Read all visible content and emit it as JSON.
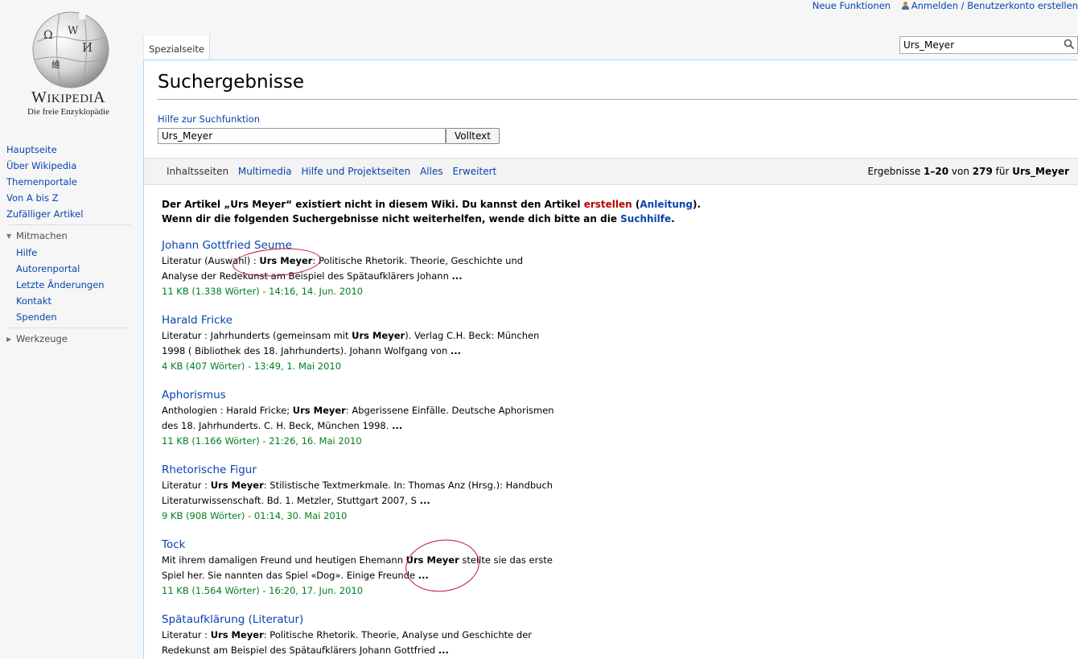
{
  "personal": {
    "new_features": "Neue Funktionen",
    "login": "Anmelden / Benutzerkonto erstellen"
  },
  "logo": {
    "wordmark_w": "W",
    "wordmark_rest": "IKIPEDI",
    "wordmark_a": "A",
    "tagline": "Die freie Enzyklopädie",
    "globe_glyphs": [
      "Ω",
      "W",
      "И",
      "維"
    ]
  },
  "nav": {
    "main": [
      "Hauptseite",
      "Über Wikipedia",
      "Themenportale",
      "Von A bis Z",
      "Zufälliger Artikel"
    ],
    "participate_head": "Mitmachen",
    "participate": [
      "Hilfe",
      "Autorenportal",
      "Letzte Änderungen",
      "Kontakt",
      "Spenden"
    ],
    "tools_head": "Werkzeuge"
  },
  "header": {
    "tab_special": "Spezialseite",
    "search_value": "Urs_Meyer"
  },
  "page": {
    "title": "Suchergebnisse",
    "help_link": "Hilfe zur Suchfunktion",
    "query": "Urs_Meyer",
    "fulltext_button": "Volltext"
  },
  "filters": {
    "tabs": [
      "Inhaltsseiten",
      "Multimedia",
      "Hilfe und Projektseiten",
      "Alles",
      "Erweitert"
    ],
    "info_prefix": "Ergebnisse ",
    "info_range": "1–20",
    "info_mid": " von ",
    "info_total": "279",
    "info_for": " für ",
    "info_query": "Urs_Meyer"
  },
  "notice": {
    "line1_a": "Der Artikel „Urs Meyer“ existiert nicht in diesem Wiki. Du kannst den Artikel ",
    "line1_create": "erstellen",
    "line1_b": " (",
    "line1_guide": "Anleitung",
    "line1_c": ").",
    "line2_a": "Wenn dir die folgenden Suchergebnisse nicht weiterhelfen, wende dich bitte an die ",
    "line2_link": "Suchhilfe",
    "line2_b": "."
  },
  "results": [
    {
      "title": "Johann Gottfried Seume",
      "l1_pre": "Literatur (Auswahl) : ",
      "l1_bold": "Urs Meyer",
      "l1_post": ": Politische Rhetorik. Theorie, Geschichte und",
      "l2_pre": "Analyse der Redekunst am Beispiel des Spätaufklärers Johann ",
      "l2_bold": "...",
      "meta": "11 KB (1.338 Wörter) - 14:16, 14. Jun. 2010"
    },
    {
      "title": "Harald Fricke",
      "l1_pre": "Literatur : Jahrhunderts (gemeinsam mit ",
      "l1_bold": "Urs Meyer",
      "l1_post": "). Verlag C.H. Beck: München",
      "l2_pre": "1998 ( Bibliothek des 18. Jahrhunderts). Johann Wolfgang von ",
      "l2_bold": "...",
      "meta": "4 KB (407 Wörter) - 13:49, 1. Mai 2010"
    },
    {
      "title": "Aphorismus",
      "l1_pre": "Anthologien : Harald Fricke; ",
      "l1_bold": "Urs Meyer",
      "l1_post": ": Abgerissene Einfälle. Deutsche Aphorismen",
      "l2_pre": "des 18. Jahrhunderts. C. H. Beck, München 1998. ",
      "l2_bold": "...",
      "meta": "11 KB (1.166 Wörter) - 21:26, 16. Mai 2010"
    },
    {
      "title": "Rhetorische Figur",
      "l1_pre": "Literatur : ",
      "l1_bold": "Urs Meyer",
      "l1_post": ": Stilistische Textmerkmale. In: Thomas Anz (Hrsg.): Handbuch",
      "l2_pre": "Literaturwissenschaft. Bd. 1. Metzler, Stuttgart 2007, S ",
      "l2_bold": "...",
      "meta": "9 KB (908 Wörter) - 01:14, 30. Mai 2010"
    },
    {
      "title": "Tock",
      "l1_pre": "Mit ihrem damaligen Freund und heutigen Ehemann ",
      "l1_bold": "Urs Meyer",
      "l1_post": " stellte sie das erste",
      "l2_pre": "Spiel her. Sie nannten das Spiel «Dog». Einige Freunde ",
      "l2_bold": "...",
      "meta": "11 KB (1.564 Wörter) - 16:20, 17. Jun. 2010"
    },
    {
      "title": "Spätaufklärung (Literatur)",
      "l1_pre": "Literatur : ",
      "l1_bold": "Urs Meyer",
      "l1_post": ": Politische Rhetorik. Theorie, Analyse und Geschichte der",
      "l2_pre": "Redekunst am Beispiel des Spätaufklärers Johann Gottfried ",
      "l2_bold": "...",
      "meta": ""
    }
  ],
  "colors": {
    "link": "#0645ad",
    "red_link": "#ba0000",
    "meta_green": "#00801e",
    "annotation": "#c0122e"
  }
}
